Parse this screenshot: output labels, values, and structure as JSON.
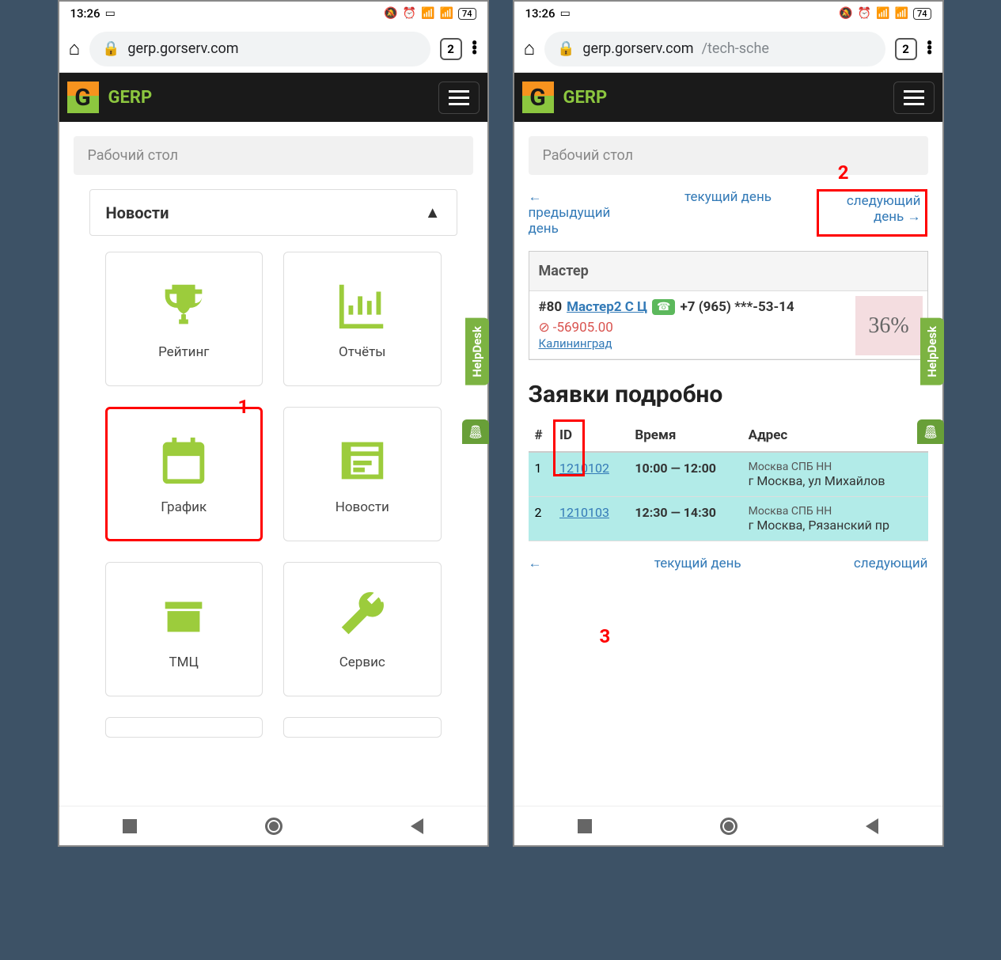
{
  "status": {
    "time": "13:26",
    "battery": "74"
  },
  "chrome": {
    "url_left": "gerp.gorserv.com",
    "url_right": "gerp.gorserv.com",
    "url_right_path": "/tech-sche",
    "tabs": "2"
  },
  "app": {
    "brand": "GERP",
    "workspace": "Рабочий стол",
    "news_section": "Новости",
    "helpdesk": "HelpDesk"
  },
  "tiles": {
    "rating": "Рейтинг",
    "reports": "Отчёты",
    "schedule": "График",
    "news": "Новости",
    "stock": "ТМЦ",
    "service": "Сервис"
  },
  "annotations": {
    "one": "1",
    "two": "2",
    "three": "3"
  },
  "daynav": {
    "prev_arrow": "←",
    "prev": "предыдущий день",
    "current": "текущий день",
    "next": "следующий день",
    "next_arrow": "→",
    "bottom_current": "текущий день",
    "bottom_next": "следующий"
  },
  "master": {
    "header": "Мастер",
    "num": "#80",
    "name": "Мастер2 С Ц",
    "phone": "+7 (965) ***-53-14",
    "balance": "-56905.00",
    "city": "Калининград",
    "percent": "36%"
  },
  "requests": {
    "title": "Заявки подробно",
    "cols": {
      "num": "#",
      "id": "ID",
      "time": "Время",
      "addr": "Адрес"
    },
    "rows": [
      {
        "n": "1",
        "id": "1210102",
        "time": "10:00 — 12:00",
        "addr1": "Москва СПБ НН",
        "addr2": "г Москва, ул Михайлов"
      },
      {
        "n": "2",
        "id": "1210103",
        "time": "12:30 — 14:30",
        "addr1": "Москва СПБ НН",
        "addr2": "г Москва, Рязанский пр"
      }
    ]
  }
}
